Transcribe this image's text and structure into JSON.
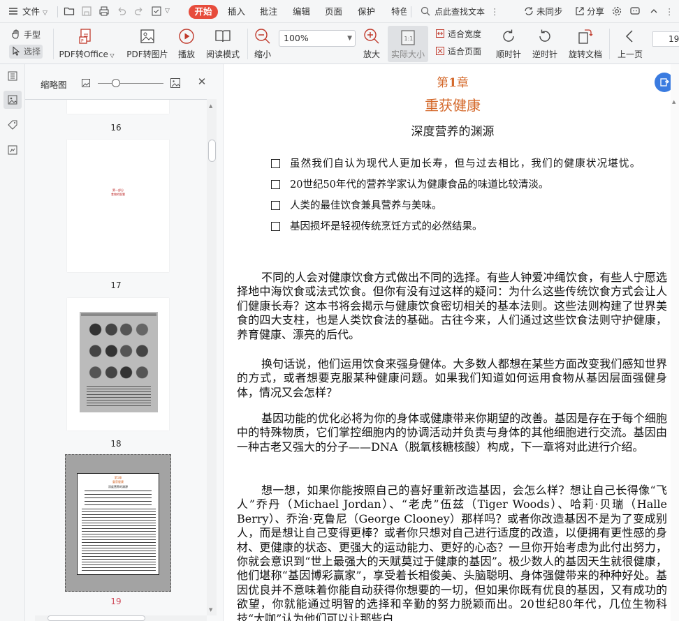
{
  "menubar": {
    "file_label": "文件",
    "tabs": [
      "开始",
      "插入",
      "批注",
      "编辑",
      "页面",
      "保护",
      "特色"
    ],
    "search_placeholder": "点此查找文本",
    "sync_label": "未同步",
    "share_label": "分享"
  },
  "toolbar": {
    "hand_label": "手型",
    "select_label": "选择",
    "pdf_to_office": "PDF转Office",
    "pdf_to_image": "PDF转图片",
    "play": "播放",
    "read_mode": "阅读模式",
    "zoom_out": "缩小",
    "zoom_value": "100%",
    "zoom_in": "放大",
    "actual_size": "实际大小",
    "fit_width": "适合宽度",
    "fit_page": "适合页面",
    "rotate_cw": "顺时针",
    "rotate_ccw": "逆时针",
    "rotate_doc": "旋转文档",
    "prev_page": "上一页",
    "page_number": "19"
  },
  "thumbnails": {
    "title": "缩略图",
    "pages": [
      {
        "number": "16"
      },
      {
        "number": "17",
        "mini_text_line1": "第一部分",
        "mini_text_line2": "食物的智慧"
      },
      {
        "number": "18"
      },
      {
        "number": "19",
        "mini_chapter": "第1章",
        "mini_title": "重获健康",
        "mini_sub": "深度营养的渊源"
      }
    ]
  },
  "document": {
    "chapter_prefix": "第",
    "chapter_num": "1",
    "chapter_suffix": "章",
    "title": "重获健康",
    "subtitle": "深度营养的渊源",
    "bullets": [
      "虽然我们自认为现代人更加长寿，但与过去相比，我们的健康状况堪忧。",
      "20世纪50年代的营养学家认为健康食品的味道比较清淡。",
      "人类的最佳饮食兼具营养与美味。",
      "基因损坏是轻视传统烹饪方式的必然结果。"
    ],
    "paragraphs": [
      "不同的人会对健康饮食方式做出不同的选择。有些人钟爱冲绳饮食，有些人宁愿选择地中海饮食或法式饮食。但你有没有过这样的疑问：为什么这些传统饮食方式会让人们健康长寿？这本书将会揭示与健康饮食密切相关的基本法则。这些法则构建了世界美食的四大支柱，也是人类饮食法的基础。古往今来，人们通过这些饮食法则守护健康，养育健康、漂亮的后代。",
      "换句话说，他们运用饮食来强身健体。大多数人都想在某些方面改变我们感知世界的方式，或者想要克服某种健康问题。如果我们知道如何运用食物从基因层面强健身体，情况又会怎样？",
      "基因功能的优化必将为你的身体或健康带来你期望的改善。基因是存在于每个细胞中的特殊物质，它们掌控细胞内的协调活动并负责与身体的其他细胞进行交流。基因由一种古老又强大的分子——DNA（脱氧核糖核酸）构成，下一章将对此进行介绍。",
      "想一想，如果你能按照自己的喜好重新改造基因，会怎么样？想让自己长得像“飞人”乔丹（Michael Jordan）、“老虎”伍兹（Tiger Woods）、哈莉·贝瑞（Halle Berry）、乔治·克鲁尼（George Clooney）那样吗？或者你改造基因不是为了变成别人，而是想让自己变得更棒？或者你只想对自己进行适度的改造，以便拥有更性感的身材、更健康的状态、更强大的运动能力、更好的心态？一旦你开始考虑为此付出努力，你就会意识到“世上最强大的天赋莫过于健康的基因”。极少数人的基因天生就很健康，他们堪称“基因博彩赢家”，享受着长相俊美、头脑聪明、身体强健带来的种种好处。基因优良并不意味着你能自动获得你想要的一切，但如果你既有优良的基因，又有成功的欲望，你就能通过明智的选择和辛勤的努力脱颖而出。20世纪80年代，几位生物科技“大咖”认为他们可以让那些白"
    ]
  }
}
